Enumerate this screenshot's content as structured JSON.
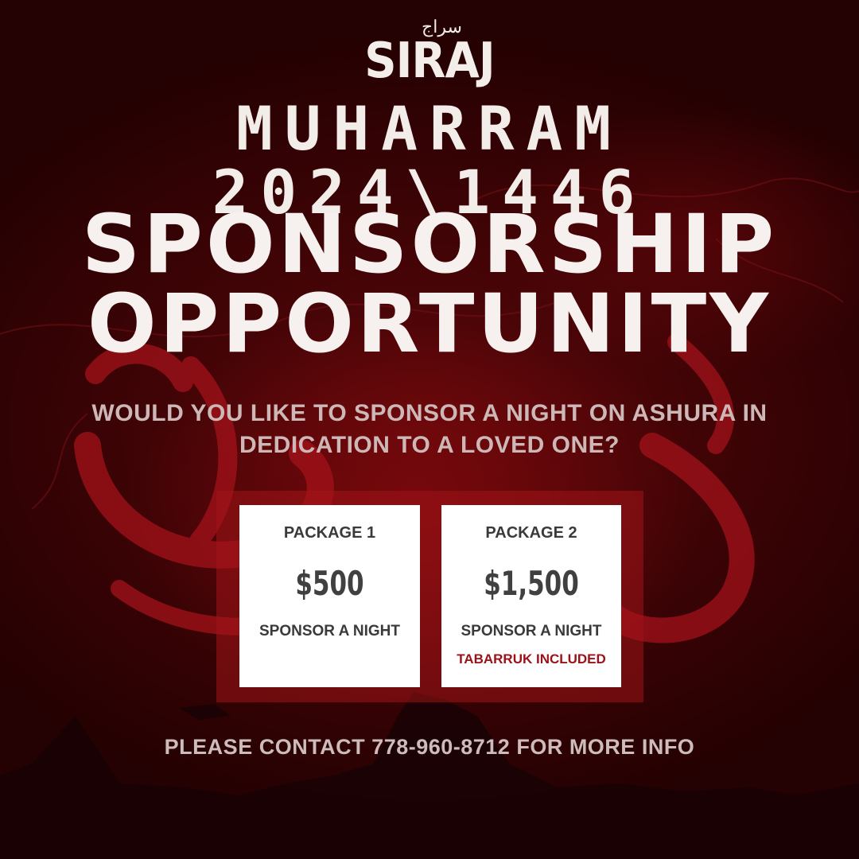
{
  "brand": {
    "logo_text": "SIRAJ",
    "logo_arabic": "سراج"
  },
  "event_title": "MUHARRAM 2024\\1446",
  "headline": {
    "line1": "SPONSORSHIP",
    "line2": "OPPORTUNITY"
  },
  "question": "WOULD YOU LIKE TO SPONSOR A NIGHT ON ASHURA IN DEDICATION TO A LOVED ONE?",
  "packages": [
    {
      "name": "PACKAGE 1",
      "price": "$500",
      "description": "SPONSOR A NIGHT",
      "extra": ""
    },
    {
      "name": "PACKAGE 2",
      "price": "$1,500",
      "description": "SPONSOR A NIGHT",
      "extra": "TABARRUK INCLUDED"
    }
  ],
  "contact": "PLEASE CONTACT 778-960-8712 FOR MORE INFO",
  "colors": {
    "background": "#3b0406",
    "panel": "#a01418",
    "accent_red": "#9c1118",
    "card": "#ffffff"
  }
}
